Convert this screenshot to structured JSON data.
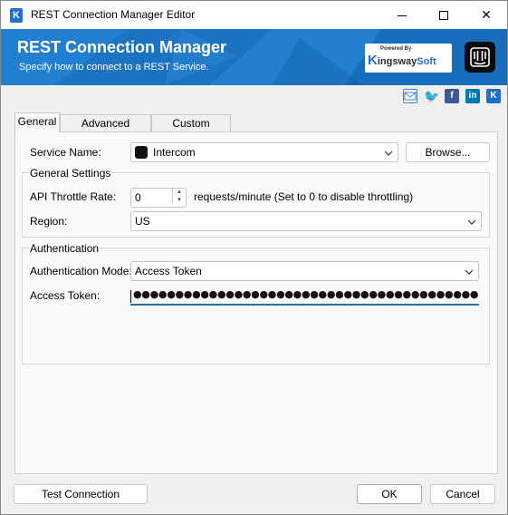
{
  "window": {
    "title": "REST Connection Manager Editor",
    "app_icon": "K",
    "controls": {
      "minimize": "minimize-icon",
      "maximize": "maximize-icon",
      "close": "✕"
    }
  },
  "banner": {
    "title": "REST Connection Manager",
    "subtitle": "Specify how to connect to a REST Service.",
    "brand_powered": "Powered By",
    "brand_k": "K",
    "brand_ingsway": "ingsway",
    "brand_soft": "Soft",
    "accent_color": "#1d78c9"
  },
  "social": {
    "twitter": "🐦",
    "facebook": "f",
    "linkedin": "in",
    "kingsway": "K"
  },
  "tabs": [
    {
      "label": "General",
      "active": true
    },
    {
      "label": "Advanced Settings",
      "active": false
    },
    {
      "label": "Custom Headers",
      "active": false
    }
  ],
  "service": {
    "label": "Service Name:",
    "value": "Intercom",
    "browse_label": "Browse..."
  },
  "general_settings": {
    "title": "General Settings",
    "throttle_label": "API Throttle Rate:",
    "throttle_value": "0",
    "throttle_hint": "requests/minute (Set to 0 to disable throttling)",
    "region_label": "Region:",
    "region_value": "US"
  },
  "authentication": {
    "title": "Authentication",
    "mode_label": "Authentication Mode:",
    "mode_value": "Access Token",
    "token_label": "Access Token:",
    "token_masked": "●●●●●●●●●●●●●●●●●●●●●●●●●●●●●●●●●●●●●●●●●●●●●●●●●●●●●●●●"
  },
  "footer": {
    "test_label": "Test Connection",
    "ok_label": "OK",
    "cancel_label": "Cancel"
  }
}
